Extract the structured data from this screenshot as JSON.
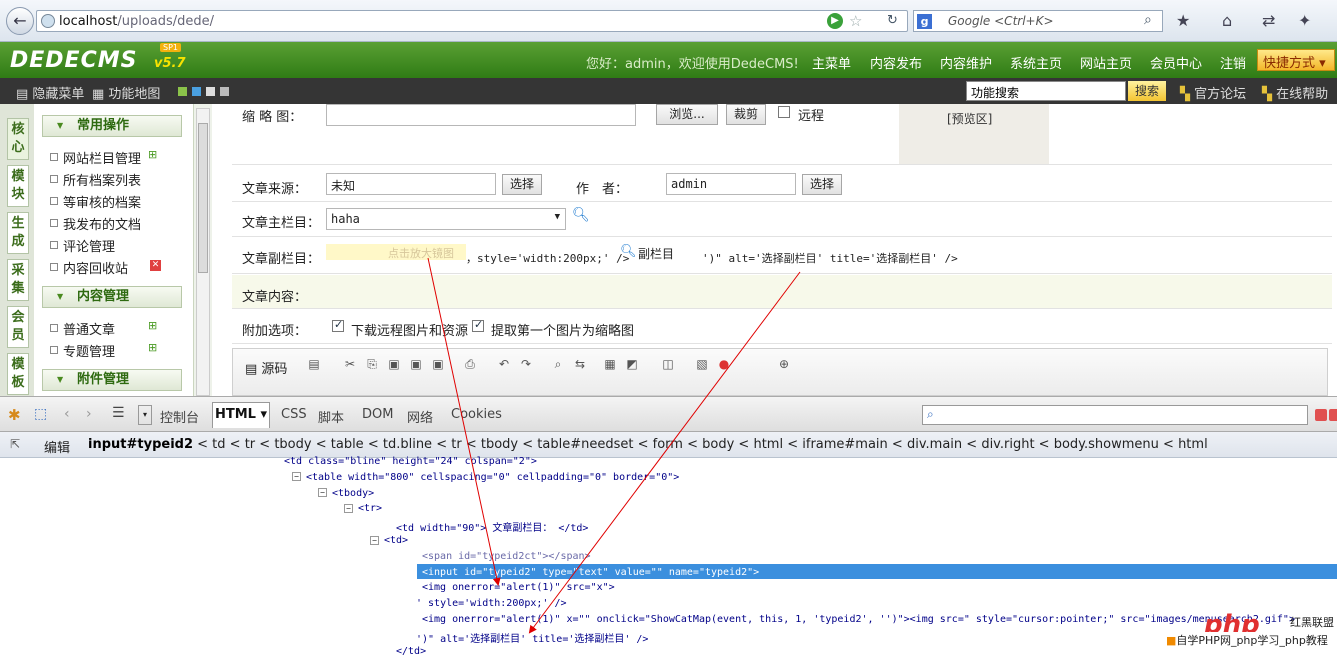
{
  "browser": {
    "url_host": "localhost",
    "url_path": "/uploads/dede/",
    "search_placeholder": "Google <Ctrl+K>",
    "search_engine_letter": "g"
  },
  "header": {
    "logo": "DEDECMS",
    "version": "v5.7",
    "badge": "SP1",
    "welcome": "您好：admin，欢迎使用DedeCMS!",
    "nav": [
      "主菜单",
      "内容发布",
      "内容维护",
      "系统主页",
      "网站主页",
      "会员中心",
      "注销"
    ],
    "quick": "快捷方式"
  },
  "toolbar": {
    "hide_menu": "隐藏菜单",
    "site_map": "功能地图",
    "search_value": "功能搜索",
    "search_btn": "搜索",
    "forum": "官方论坛",
    "help": "在线帮助"
  },
  "sidebar": {
    "tabs": [
      "核心",
      "模块",
      "生成",
      "采集",
      "会员",
      "模板"
    ],
    "groups": [
      {
        "title": "常用操作",
        "items": [
          "网站栏目管理",
          "所有档案列表",
          "等审核的档案",
          "我发布的文档",
          "评论管理",
          "内容回收站"
        ]
      },
      {
        "title": "内容管理",
        "items": [
          "普通文章",
          "专题管理"
        ]
      },
      {
        "title": "附件管理",
        "items": []
      }
    ]
  },
  "form": {
    "thumb_label": "缩 略 图：",
    "browse_btn": "浏览...",
    "crop_btn": "裁剪",
    "remote_label": "远程",
    "preview": "[预览区]",
    "source_label": "文章来源：",
    "source_value": "未知",
    "select_btn": "选择",
    "author_label": "作　者：",
    "author_value": "admin",
    "main_col_label": "文章主栏目：",
    "main_col_value": "haha",
    "sub_col_label": "文章副栏目：",
    "sub_col_hint": "点击放大镜图",
    "sub_col_tail1": "，style='width:200px;' />",
    "sub_col_icon_label": "副栏目",
    "sub_col_tail2": "')\" alt='选择副栏目' title='选择副栏目' />",
    "content_label": "文章内容：",
    "extra_label": "附加选项：",
    "download_label": "下载远程图片和资源",
    "extract_label": "提取第一个图片为缩略图",
    "source_btn": "源码"
  },
  "firebug": {
    "tabs": [
      "控制台",
      "HTML",
      "CSS",
      "脚本",
      "DOM",
      "网络",
      "Cookies"
    ],
    "edit": "编辑",
    "crumbs": [
      "input#typeid2",
      "td",
      "tr",
      "tbody",
      "table",
      "td.bline",
      "tr",
      "tbody",
      "table#needset",
      "form",
      "body",
      "html",
      "iframe#main",
      "div.main",
      "div.right",
      "body.showmenu",
      "html"
    ],
    "tree": [
      {
        "indent": 284,
        "text": "<td class=\"bline\" height=\"24\" colspan=\"2\">",
        "tw": ""
      },
      {
        "indent": 306,
        "text": "<table width=\"800\" cellspacing=\"0\" cellpadding=\"0\" border=\"0\">",
        "tw": "−"
      },
      {
        "indent": 332,
        "text": "<tbody>",
        "tw": "−"
      },
      {
        "indent": 358,
        "text": "<tr>",
        "tw": "−"
      },
      {
        "indent": 396,
        "text": "<td width=\"90\"> 文章副栏目： </td>",
        "tw": ""
      },
      {
        "indent": 384,
        "text": "<td>",
        "tw": "−"
      },
      {
        "indent": 422,
        "text": "<span id=\"typeid2ct\"></span>",
        "tw": ""
      },
      {
        "indent": 422,
        "text": "<input id=\"typeid2\" type=\"text\" value=\"\" name=\"typeid2\">",
        "tw": ""
      },
      {
        "indent": 422,
        "text": "<img onerror=\"alert(1)\" src=\"x\">",
        "tw": ""
      },
      {
        "indent": 416,
        "text": "' style='width:200px;' />",
        "tw": ""
      },
      {
        "indent": 422,
        "text": "<img onerror=\"alert(1)\" x=\"\" onclick=\"ShowCatMap(event, this, 1, 'typeid2', '')\"><img src=\" style=\"cursor:pointer;\" src=\"images/menusearch2.gif\">",
        "tw": ""
      },
      {
        "indent": 416,
        "text": "')\" alt='选择副栏目' title='选择副栏目' />",
        "tw": ""
      },
      {
        "indent": 396,
        "text": "</td>",
        "tw": ""
      }
    ]
  },
  "watermark": {
    "logo": "php",
    "text1": "红黑联盟",
    "text2": "自学PHP网_php学习_php教程"
  }
}
